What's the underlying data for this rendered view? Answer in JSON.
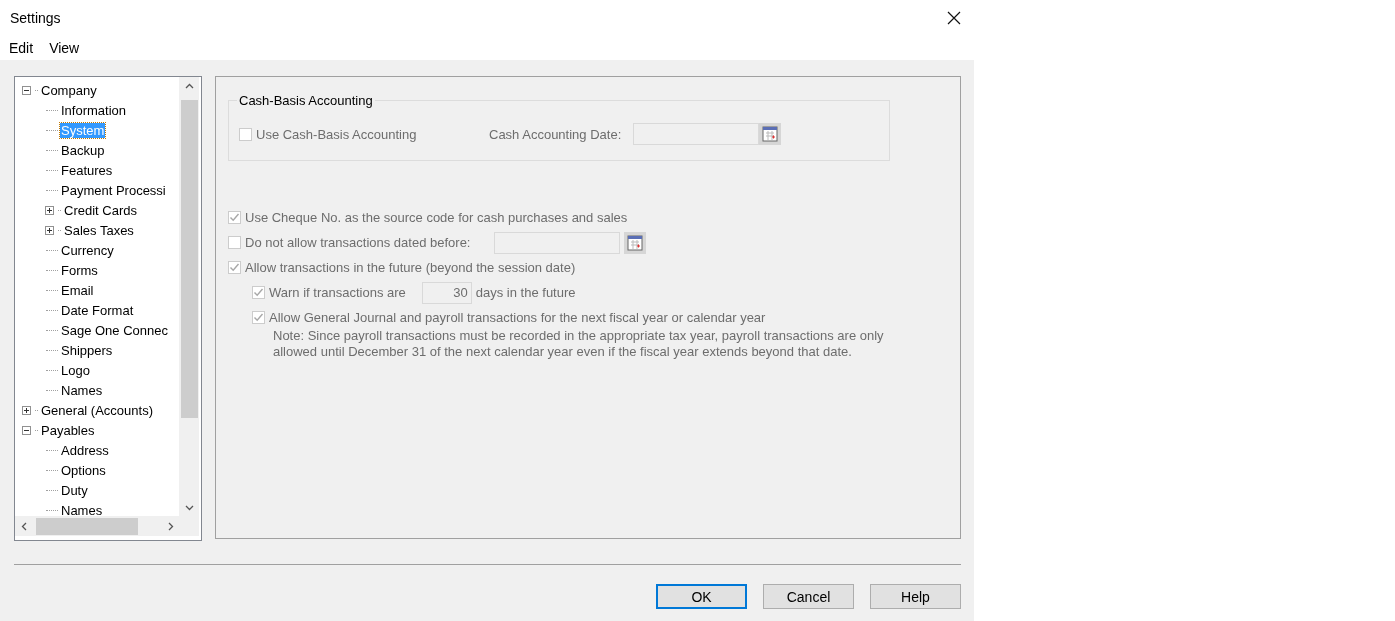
{
  "window": {
    "title": "Settings"
  },
  "menu": [
    {
      "label": "Edit"
    },
    {
      "label": "View"
    }
  ],
  "tree": [
    {
      "label": "Company",
      "expanded": true,
      "selected": false,
      "children": [
        {
          "label": "Information",
          "selected": false
        },
        {
          "label": "System",
          "selected": true
        },
        {
          "label": "Backup",
          "selected": false
        },
        {
          "label": "Features",
          "selected": false
        },
        {
          "label": "Payment Processi",
          "selected": false
        },
        {
          "label": "Credit Cards",
          "expanded": false,
          "selected": false
        },
        {
          "label": "Sales Taxes",
          "expanded": false,
          "selected": false
        },
        {
          "label": "Currency",
          "selected": false
        },
        {
          "label": "Forms",
          "selected": false
        },
        {
          "label": "Email",
          "selected": false
        },
        {
          "label": "Date Format",
          "selected": false
        },
        {
          "label": "Sage One Connec",
          "selected": false
        },
        {
          "label": "Shippers",
          "selected": false
        },
        {
          "label": "Logo",
          "selected": false
        },
        {
          "label": "Names",
          "selected": false
        }
      ]
    },
    {
      "label": "General (Accounts)",
      "expanded": false,
      "selected": false
    },
    {
      "label": "Payables",
      "expanded": true,
      "selected": false,
      "children": [
        {
          "label": "Address",
          "selected": false
        },
        {
          "label": "Options",
          "selected": false
        },
        {
          "label": "Duty",
          "selected": false
        },
        {
          "label": "Names",
          "selected": false
        }
      ]
    }
  ],
  "cash_basis": {
    "title": "Cash-Basis Accounting",
    "option": {
      "label": "Use Cash-Basis Accounting",
      "checked": false,
      "disabled": true
    },
    "date_label": "Cash Accounting Date:"
  },
  "options": [
    {
      "kind": "checkbox",
      "label": "Use Cheque No. as the source code for cash purchases and sales",
      "checked": true,
      "disabled": true
    },
    {
      "kind": "date",
      "label": "Do not allow transactions dated before:",
      "checked": false,
      "disabled": true
    },
    {
      "kind": "checkbox",
      "label": "Allow transactions in the future (beyond the session date)",
      "checked": true,
      "disabled": true,
      "children": [
        {
          "kind": "number",
          "label": "Warn if transactions are",
          "value": "30",
          "suffix": "days in the future",
          "checked": true,
          "disabled": true
        },
        {
          "kind": "checkbox",
          "label": "Allow General Journal and payroll transactions for the next fiscal year or calendar year",
          "checked": true,
          "disabled": true,
          "note": "Note: Since payroll transactions must be recorded in the appropriate tax year, payroll transactions are only allowed until December 31 of the next calendar year even if the fiscal year extends beyond that date."
        }
      ]
    }
  ],
  "buttons": [
    {
      "label": "OK",
      "default": true
    },
    {
      "label": "Cancel",
      "default": false
    },
    {
      "label": "Help",
      "default": false
    }
  ]
}
